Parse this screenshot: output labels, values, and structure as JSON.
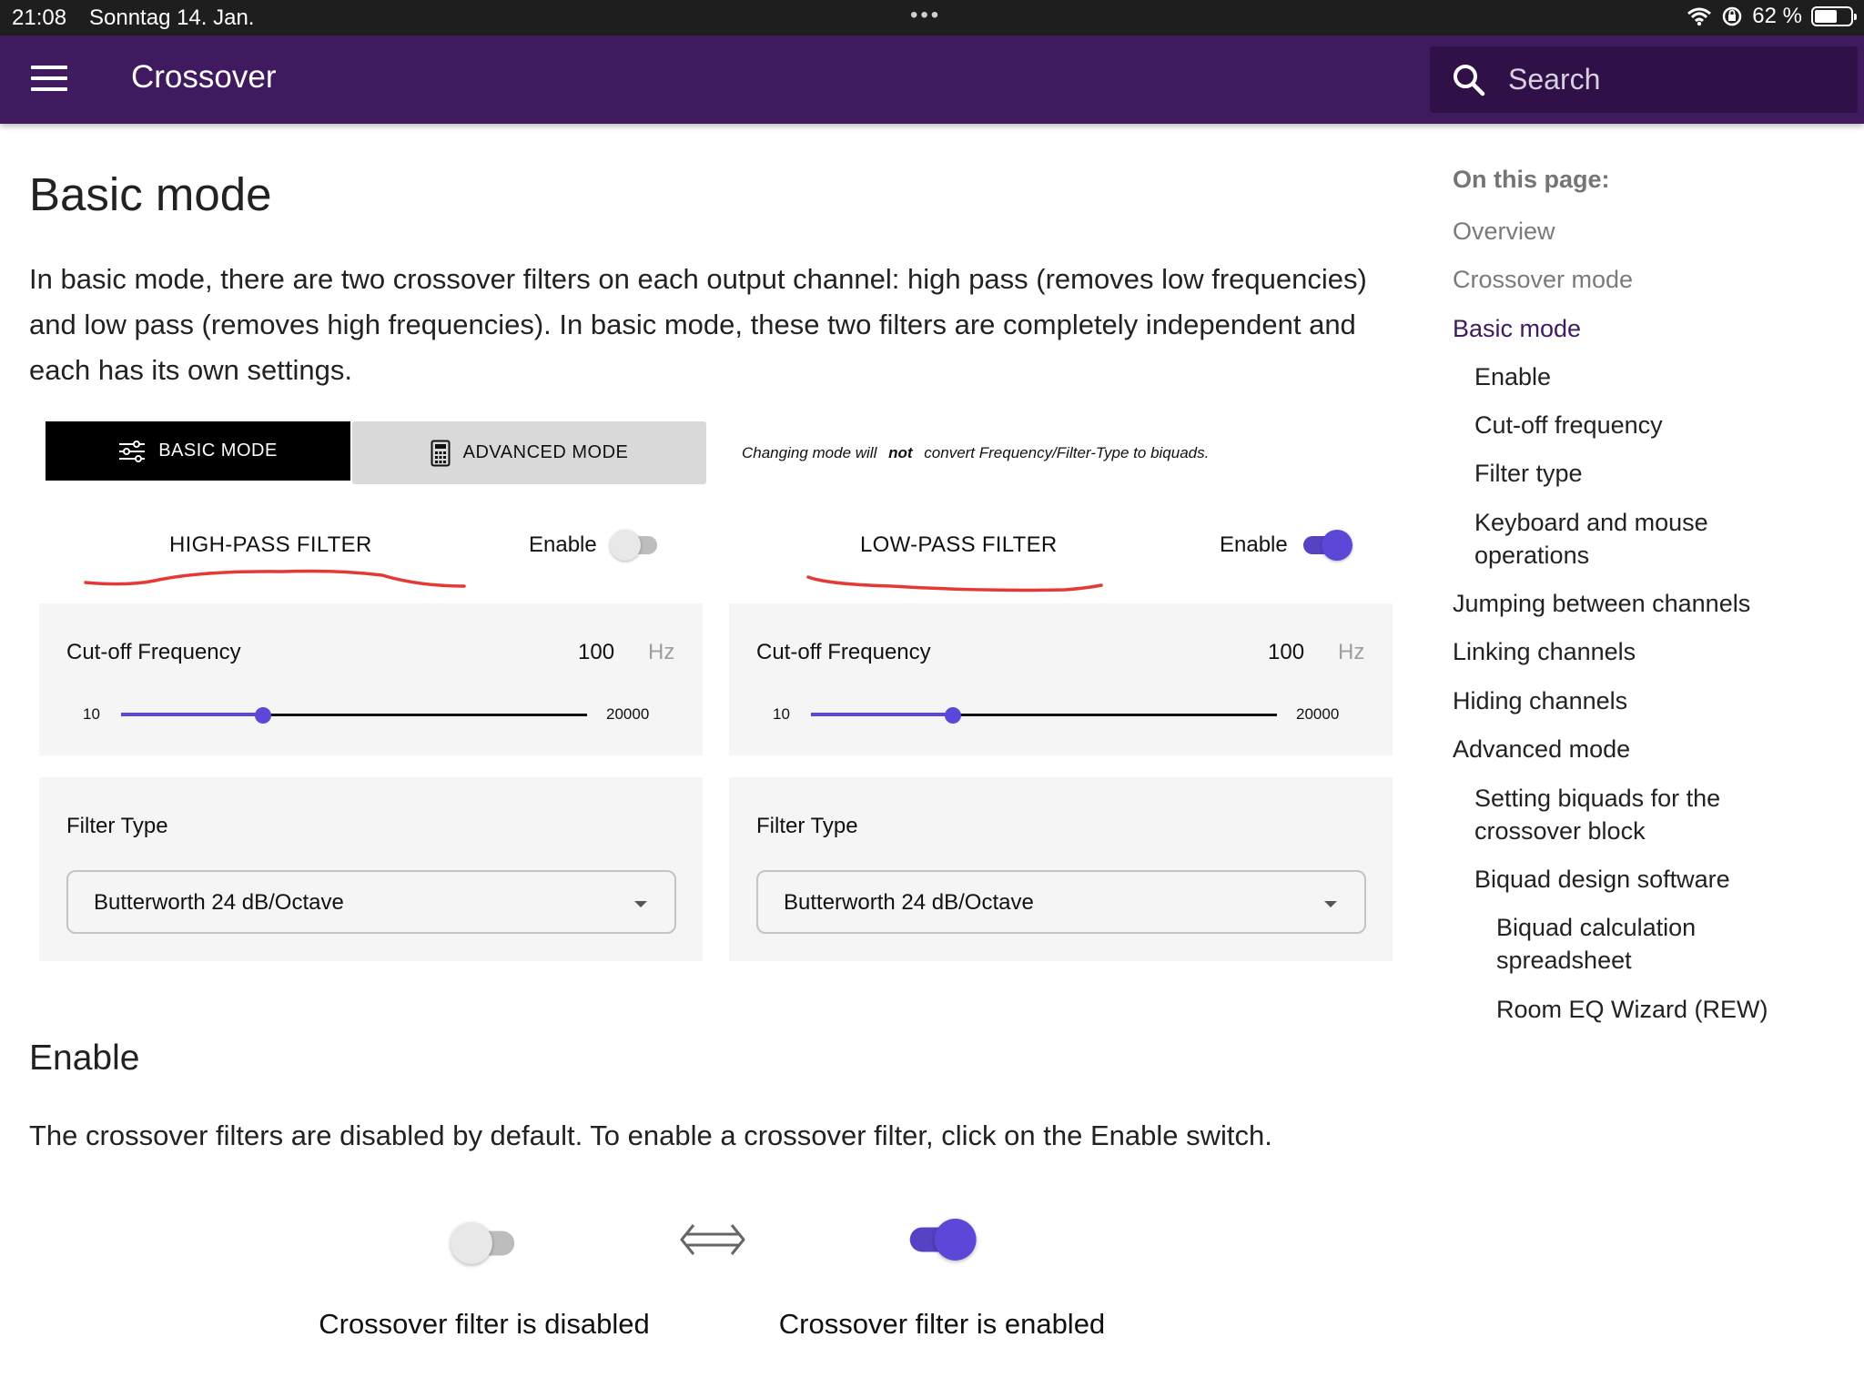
{
  "status_bar": {
    "time": "21:08",
    "date": "Sonntag 14. Jan.",
    "battery": "62 %",
    "more_dots": "•••"
  },
  "app_bar": {
    "title": "Crossover",
    "search_placeholder": "Search"
  },
  "main": {
    "title": "Basic mode",
    "intro": "In basic mode, there are two crossover filters on each output channel: high pass (removes low frequencies) and low pass (removes high frequencies). In basic mode, these two filters are completely independent and each has its own settings.",
    "mode_buttons": {
      "basic": "BASIC MODE",
      "advanced": "ADVANCED MODE"
    },
    "mode_note": {
      "before": "Changing mode will",
      "emphasis": "not",
      "after": "convert Frequency/Filter-Type to biquads."
    },
    "filters": [
      {
        "name": "HIGH-PASS FILTER",
        "enable_label": "Enable",
        "enabled": false,
        "cutoff_label": "Cut-off Frequency",
        "cutoff_value": "100",
        "unit": "Hz",
        "slider_min": "10",
        "slider_max": "20000",
        "slider_fraction": 0.305,
        "filter_type_label": "Filter Type",
        "filter_type_value": "Butterworth 24 dB/Octave"
      },
      {
        "name": "LOW-PASS FILTER",
        "enable_label": "Enable",
        "enabled": true,
        "cutoff_label": "Cut-off Frequency",
        "cutoff_value": "100",
        "unit": "Hz",
        "slider_min": "10",
        "slider_max": "20000",
        "slider_fraction": 0.305,
        "filter_type_label": "Filter Type",
        "filter_type_value": "Butterworth 24 dB/Octave"
      }
    ],
    "enable_section": {
      "title": "Enable",
      "text": "The crossover filters are disabled by default. To enable a crossover filter, click on the Enable switch.",
      "caption_disabled": "Crossover filter is disabled",
      "caption_enabled": "Crossover filter is enabled"
    }
  },
  "toc": {
    "heading": "On this page:",
    "items": [
      {
        "label": "Overview",
        "level": 1,
        "state": "muted"
      },
      {
        "label": "Crossover mode",
        "level": 1,
        "state": "muted"
      },
      {
        "label": "Basic mode",
        "level": 1,
        "state": "active"
      },
      {
        "label": "Enable",
        "level": 2,
        "state": "normal"
      },
      {
        "label": "Cut-off frequency",
        "level": 2,
        "state": "normal"
      },
      {
        "label": "Filter type",
        "level": 2,
        "state": "normal"
      },
      {
        "label": "Keyboard and mouse",
        "label2": "operations",
        "level": 2,
        "state": "normal"
      },
      {
        "label": "Jumping between channels",
        "level": 1,
        "state": "normal"
      },
      {
        "label": "Linking channels",
        "level": 1,
        "state": "normal"
      },
      {
        "label": "Hiding channels",
        "level": 1,
        "state": "normal"
      },
      {
        "label": "Advanced mode",
        "level": 1,
        "state": "normal"
      },
      {
        "label": "Setting biquads for the",
        "label2": "crossover block",
        "level": 2,
        "state": "normal"
      },
      {
        "label": "Biquad design software",
        "level": 2,
        "state": "normal"
      },
      {
        "label": "Biquad calculation",
        "label2": "spreadsheet",
        "level": 3,
        "state": "normal"
      },
      {
        "label": "Room EQ Wizard (REW)",
        "level": 3,
        "state": "normal"
      }
    ]
  },
  "colors": {
    "app_bar": "#3f1a5e",
    "search_bg": "#2f1148",
    "accent": "#5b48d8",
    "annotation": "#e53935",
    "panel_bg": "#f5f5f5"
  },
  "icons": [
    "menu-icon",
    "search-icon",
    "wifi-icon",
    "rotation-lock-icon",
    "battery-icon",
    "sliders-icon",
    "calculator-icon",
    "double-arrow-icon",
    "caret-down-icon"
  ]
}
